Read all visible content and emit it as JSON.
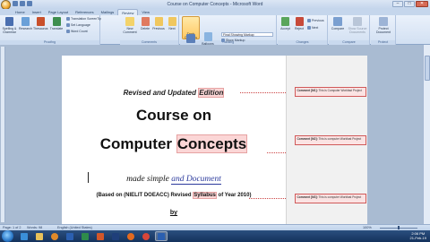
{
  "window": {
    "title": "Course on Computer Concepts - Microsoft Word",
    "controls": [
      "–",
      "□",
      "✕"
    ]
  },
  "tabs": [
    "Home",
    "Insert",
    "Page Layout",
    "References",
    "Mailings",
    "Review",
    "View"
  ],
  "active_tab": "Review",
  "ribbon": {
    "proofing": {
      "label": "Proofing",
      "spelling": "Spelling & Grammar",
      "research": "Research",
      "thesaurus": "Thesaurus",
      "translate": "Translate",
      "translation_screentip": "Translation ScreenTip",
      "set_language": "Set Language",
      "word_count": "Word Count"
    },
    "comments": {
      "label": "Comments",
      "new": "New Comment",
      "delete": "Delete",
      "previous": "Previous",
      "next": "Next"
    },
    "tracking": {
      "label": "Tracking",
      "track_changes": "Track Changes",
      "balloons": "Balloons",
      "display": "Final Showing Markup",
      "show_markup": "Show Markup",
      "reviewing_pane": "Reviewing Pane"
    },
    "changes": {
      "label": "Changes",
      "accept": "Accept",
      "reject": "Reject",
      "previous": "Previous",
      "next": "Next"
    },
    "compare": {
      "label": "Compare",
      "compare": "Compare",
      "show_source": "Show Source Documents"
    },
    "protect": {
      "label": "Protect",
      "protect_doc": "Protect Document"
    }
  },
  "document": {
    "line1_pre": "Revised and Updated ",
    "line1_hl": "Edition",
    "line2": "Course on",
    "line3_pre": "Computer ",
    "line3_hl": "Concepts",
    "line4_pre": "made simple ",
    "line4_u": "and Document",
    "line5_pre": "(Based on (NIELIT DOEACC) Revised ",
    "line5_hl": "Syllabus",
    "line5_post": " of Year 2010)",
    "line6": "by"
  },
  "comments": [
    {
      "id": "Comment [M1]:",
      "text": "This is Computer  Workfast Project"
    },
    {
      "id": "Comment [M2]:",
      "text": "This is computer  Workfast Project"
    },
    {
      "id": "Comment [M3]:",
      "text": "This is computer  Workfast Project"
    }
  ],
  "status": {
    "page": "Page: 1 of 2",
    "words": "Words: 98",
    "language": "English (United States)",
    "zoom": "100%"
  },
  "taskbar": {
    "time": "2:06 PM",
    "date": "21-Feb-19"
  }
}
